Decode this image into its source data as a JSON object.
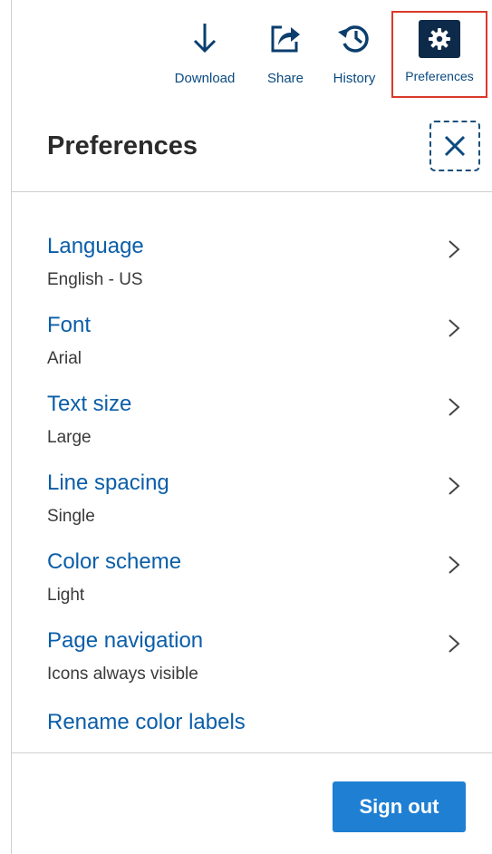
{
  "toolbar": {
    "download_label": "Download",
    "share_label": "Share",
    "history_label": "History",
    "preferences_label": "Preferences"
  },
  "panel": {
    "title": "Preferences",
    "items": [
      {
        "label": "Language",
        "value": "English - US"
      },
      {
        "label": "Font",
        "value": "Arial"
      },
      {
        "label": "Text size",
        "value": "Large"
      },
      {
        "label": "Line spacing",
        "value": "Single"
      },
      {
        "label": "Color scheme",
        "value": "Light"
      },
      {
        "label": "Page navigation",
        "value": "Icons always visible"
      }
    ],
    "rename_label": "Rename color labels",
    "sign_out_label": "Sign out"
  },
  "colors": {
    "link": "#0b5ea8",
    "accent_button": "#1f7fd3",
    "highlight_border": "#d93a2b",
    "gear_bg": "#0d2a4a"
  },
  "icons": {
    "download": "download-icon",
    "share": "share-icon",
    "history": "history-icon",
    "preferences": "gear-icon",
    "close": "close-icon",
    "chevron": "chevron-right-icon"
  }
}
